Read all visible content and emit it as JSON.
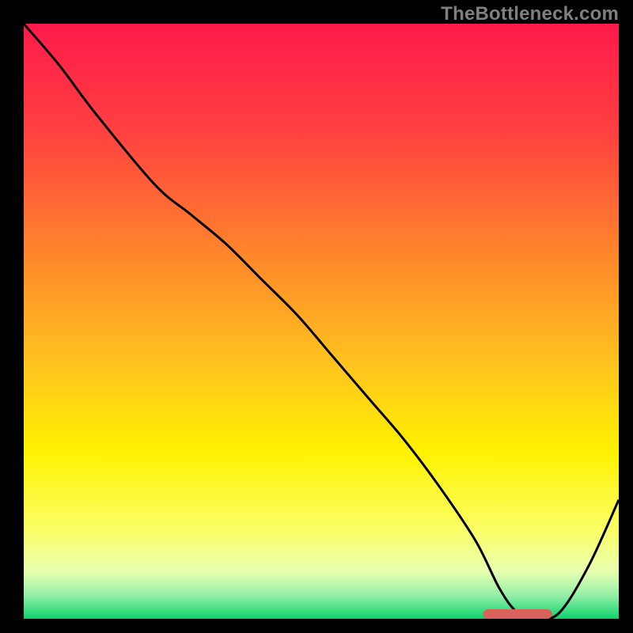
{
  "watermark": "TheBottleneck.com",
  "chart_data": {
    "type": "line",
    "title": "",
    "xlabel": "",
    "ylabel": "",
    "xlim": [
      0,
      100
    ],
    "ylim": [
      0,
      100
    ],
    "grid": false,
    "legend": false,
    "gradient_stops": [
      {
        "pct": 0,
        "color": "#ff1a4b"
      },
      {
        "pct": 18,
        "color": "#ff4040"
      },
      {
        "pct": 40,
        "color": "#ff8a2a"
      },
      {
        "pct": 58,
        "color": "#ffc61e"
      },
      {
        "pct": 72,
        "color": "#fff200"
      },
      {
        "pct": 85,
        "color": "#fbff66"
      },
      {
        "pct": 92,
        "color": "#e8ffb0"
      },
      {
        "pct": 96,
        "color": "#97f0a8"
      },
      {
        "pct": 100,
        "color": "#0fd16c"
      }
    ],
    "series": [
      {
        "name": "bottleneck-curve",
        "color": "#000000",
        "x": [
          0,
          6,
          12,
          22,
          28,
          34,
          40,
          46,
          52,
          58,
          64,
          70,
          76,
          80,
          83,
          86,
          90,
          95,
          100
        ],
        "y": [
          100,
          93,
          85,
          73,
          68,
          63,
          57,
          51,
          44,
          37,
          30,
          22,
          13,
          5,
          1,
          0,
          1,
          9,
          20
        ]
      },
      {
        "name": "optimal-zone-marker",
        "color": "#d9635b",
        "x": [
          78,
          88
        ],
        "y": [
          0.8,
          0.8
        ]
      }
    ]
  }
}
